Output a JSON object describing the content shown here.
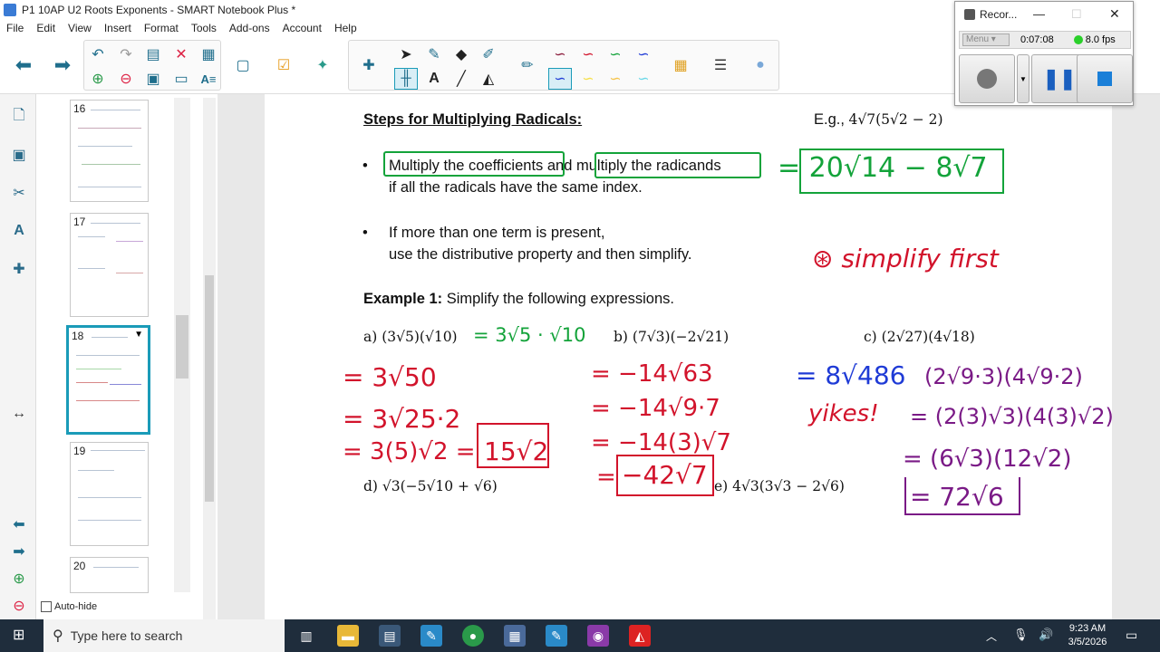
{
  "window": {
    "title": "P1 10AP U2 Roots Exponents - SMART Notebook Plus *"
  },
  "menu": [
    "File",
    "Edit",
    "View",
    "Insert",
    "Format",
    "Tools",
    "Add-ons",
    "Account",
    "Help"
  ],
  "sorter": {
    "pages": [
      {
        "num": "16"
      },
      {
        "num": "17"
      },
      {
        "num": "18"
      },
      {
        "num": "19"
      },
      {
        "num": "20"
      }
    ],
    "autohide_label": "Auto-hide"
  },
  "slide": {
    "heading": "Steps for Multiplying Radicals:",
    "eg_prefix": "E.g., ",
    "eg_expr": "4√7(5√2 − 2)",
    "bullet1_part1": "Multiply the coefficients",
    "bullet1_and": "and",
    "bullet1_part2": "multiply the radicands",
    "bullet1_line2": "if all the radicals have the same index.",
    "bullet2_line1": "If more than one term is present,",
    "bullet2_line2": "use the distributive property and then simplify.",
    "example_label": "Example 1:",
    "example_text": " Simplify the following expressions.",
    "part_a": "a) (3√5)(√10)",
    "part_b": "b) (7√3)(−2√21)",
    "part_c": "c) (2√27)(4√18)",
    "part_d": "d) √3(−5√10 + √6)",
    "part_e": "e) 4√3(3√3 − 2√6)"
  },
  "ink": {
    "eg_answer": "= 20√14 − 8√7",
    "simplify_first": "⊛ simplify first",
    "a_step0": "= 3√5 · √10",
    "a_step1": "= 3√50",
    "a_step2": "= 3√25·2",
    "a_step3": "= 3(5)√2 =",
    "a_answer": "15√2",
    "b_step1": "= −14√63",
    "b_step2": "= −14√9·7",
    "b_step3": "= −14(3)√7",
    "b_step4": "=",
    "b_answer": "−42√7",
    "c_step1": "= 8√486",
    "c_yikes": "yikes!",
    "c_alt1": "(2√9·3)(4√9·2)",
    "c_alt2": "= (2(3)√3)(4(3)√2)",
    "c_alt3": "= (6√3)(12√2)",
    "c_answer": "= 72√6"
  },
  "recorder": {
    "title": "Recor...",
    "menu_label": "Menu",
    "time": "0:07:08",
    "fps": "8.0 fps"
  },
  "taskbar": {
    "search_placeholder": "Type here to search",
    "time": "9:23 AM",
    "date": "3/5/2026"
  },
  "colors": {
    "ink_green": "#13a33a",
    "ink_red": "#d2132b",
    "ink_blue": "#1f3bd6",
    "ink_purple": "#7a1a86",
    "selected_page": "#1a9bb8",
    "taskbar": "#1f2d3c"
  }
}
